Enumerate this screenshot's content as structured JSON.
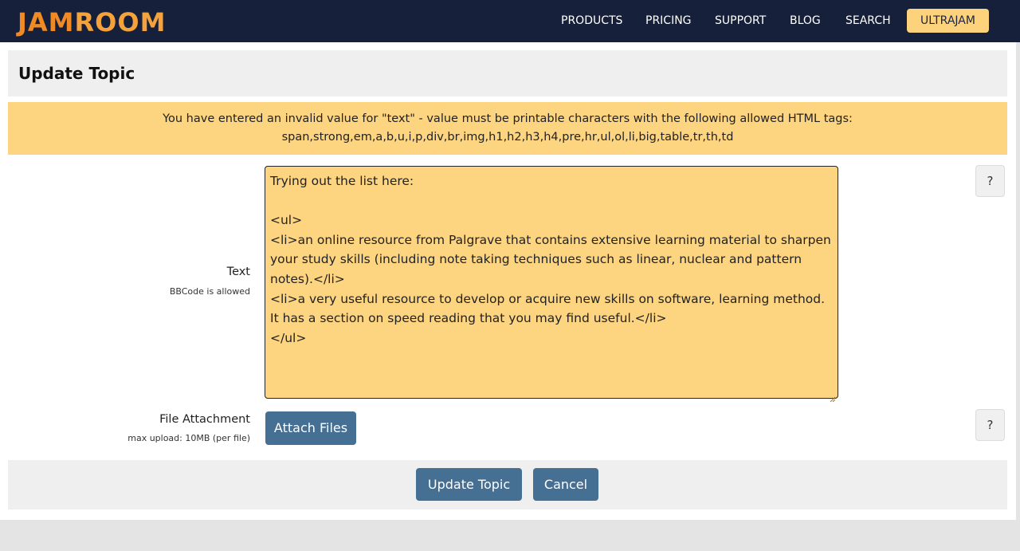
{
  "brand": {
    "logo_text_a": "JAM",
    "logo_text_b": "ROOM"
  },
  "nav": {
    "items": [
      {
        "label": "PRODUCTS"
      },
      {
        "label": "PRICING"
      },
      {
        "label": "SUPPORT"
      },
      {
        "label": "BLOG"
      },
      {
        "label": "SEARCH"
      }
    ],
    "highlight": "ULTRAJAM"
  },
  "page": {
    "title": "Update Topic"
  },
  "error": {
    "line1": "You have entered an invalid value for \"text\" - value must be printable characters with the following allowed HTML tags:",
    "line2": "span,strong,em,a,b,u,i,p,div,br,img,h1,h2,h3,h4,pre,hr,ul,ol,li,big,table,tr,th,td"
  },
  "form": {
    "text_label": "Text",
    "text_sublabel": "BBCode is allowed",
    "text_value": "Trying out the list here:\n\n<ul>\n<li>an online resource from Palgrave that contains extensive learning material to sharpen your study skills (including note taking techniques such as linear, nuclear and pattern notes).</li>\n<li>a very useful resource to develop or acquire new skills on software, learning method. It has a section on speed reading that you may find useful.</li>\n</ul>",
    "file_label": "File Attachment",
    "file_sublabel": "max upload: 10MB (per file)",
    "attach_label": "Attach Files",
    "help_label": "?"
  },
  "actions": {
    "submit_label": "Update Topic",
    "cancel_label": "Cancel"
  },
  "colors": {
    "topbar": "#17203a",
    "accent": "#fdd47f",
    "button": "#456f93",
    "logo": "#f08a24"
  }
}
